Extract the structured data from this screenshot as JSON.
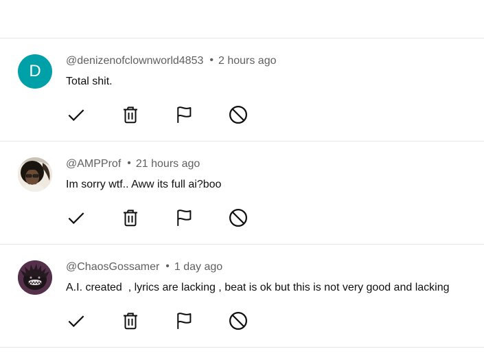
{
  "comments": [
    {
      "avatar_letter": "D",
      "avatar_color": "#00a0a8",
      "handle": "@denizenofclownworld4853",
      "separator": "•",
      "time": "2 hours ago",
      "text": "Total shit."
    },
    {
      "handle": "@AMPProf",
      "separator": "•",
      "time": "21 hours ago",
      "text": "Im sorry wtf.. Aww its full ai?boo"
    },
    {
      "handle": "@ChaosGossamer",
      "separator": "•",
      "time": "1 day ago",
      "text": "A.I. created  , lyrics are lacking , beat is ok but this is not very good and lacking"
    }
  ],
  "actions": {
    "approve_icon": "check-icon",
    "delete_icon": "trash-icon",
    "report_icon": "flag-icon",
    "hide_user_icon": "block-icon"
  }
}
